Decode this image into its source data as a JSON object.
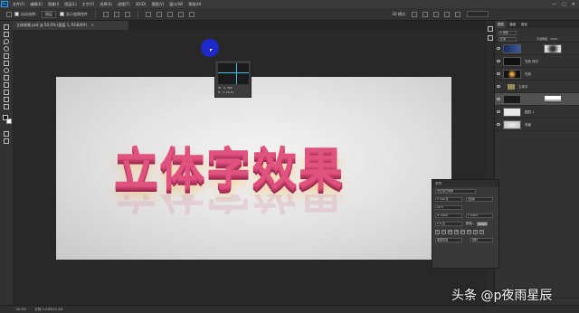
{
  "app": {
    "logo": "Ps",
    "menu": [
      "文件(F)",
      "编辑(E)",
      "图像(I)",
      "图层(L)",
      "文字(Y)",
      "选择(S)",
      "滤镜(T)",
      "3D(D)",
      "视图(V)",
      "窗口(W)",
      "帮助(H)"
    ],
    "window_controls": [
      "—",
      "▢",
      "✕"
    ]
  },
  "options_bar": {
    "auto_select_label": "自动选择：",
    "auto_select_target": "图层",
    "show_transform_label": "显示变换控件",
    "mode_label": "3D 模式："
  },
  "document_tab": {
    "title": "立体效果.psd @ 50.0% (图层 1, RGB/8#)",
    "close": "×"
  },
  "canvas": {
    "art_text": "立体字效果"
  },
  "guide_popup": {
    "info_line1": "W：X: 399",
    "info_line2": "H：Y: 18.74"
  },
  "layers_panel": {
    "tabs": [
      "图层",
      "通道",
      "路径"
    ],
    "filter_label": "P 类型",
    "blend_mode": "正常",
    "opacity": "不透明度：100%",
    "layers": [
      {
        "name": "",
        "type": "effect-thumb",
        "selected": false
      },
      {
        "name": "光效 拷贝",
        "type": "dark-thumb",
        "selected": false
      },
      {
        "name": "光效",
        "type": "dark-thumb",
        "selected": false
      },
      {
        "name": "立体字",
        "type": "group",
        "selected": false
      },
      {
        "name": "",
        "type": "masked",
        "selected": true
      },
      {
        "name": "图层 1",
        "type": "gray-thumb",
        "selected": false
      },
      {
        "name": "背景",
        "type": "bg-thumb",
        "selected": false
      }
    ]
  },
  "character_panel": {
    "title": "字符",
    "font": "方正综艺简体",
    "size": "T 100 点",
    "leading": "(自动)",
    "tracking": "VA 0",
    "scale_v": "IT 100%",
    "scale_h": "T 100%",
    "baseline": "A 0 点",
    "color_label": "颜色：",
    "styles": [
      "T",
      "T",
      "TT",
      "Tr",
      "T¹",
      "T₁",
      "T",
      "T"
    ],
    "language": "美国英语",
    "aa": "锐利"
  },
  "status_bar": {
    "zoom": "50.0%",
    "doc_info": "文档:3.01M/25.2M"
  },
  "watermark": {
    "text": "头条 @p夜雨星辰"
  },
  "colors": {
    "accent_guide": "#39c7e6",
    "art_text": "#e0527f",
    "cursor": "#1d29c9"
  }
}
